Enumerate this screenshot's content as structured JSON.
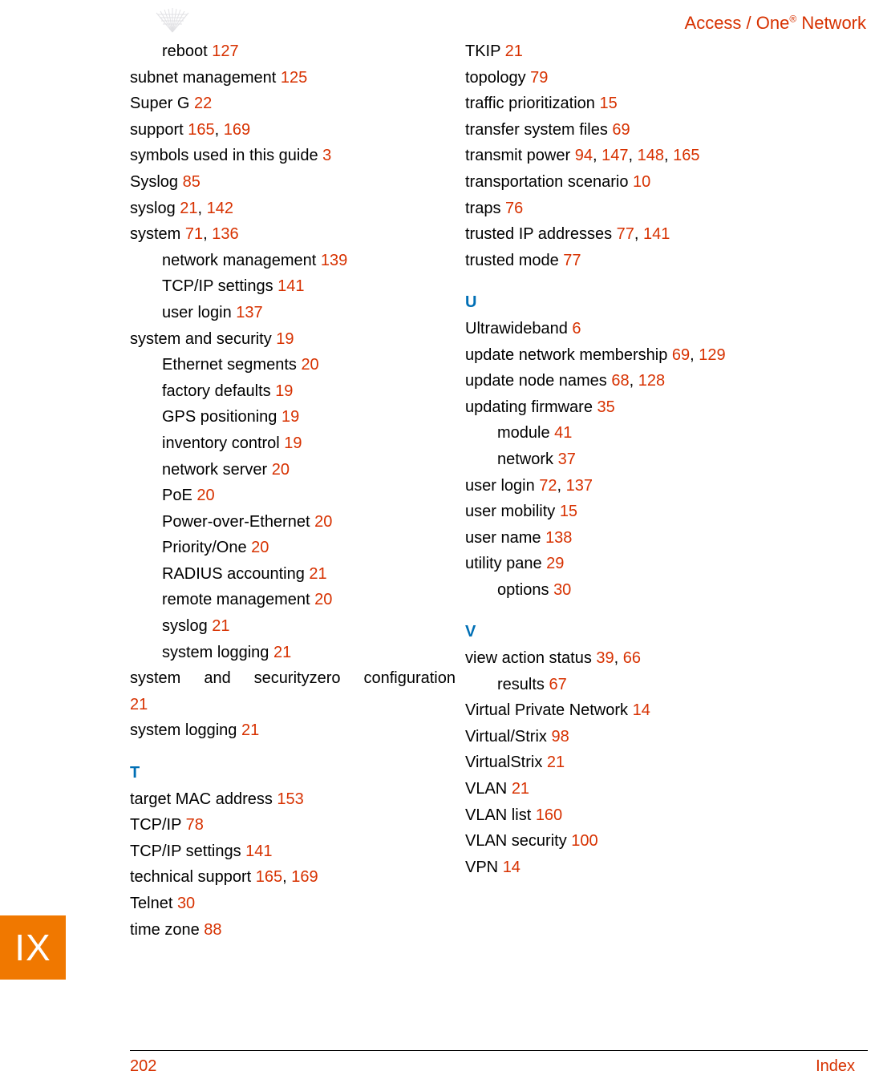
{
  "header": {
    "title_prefix": "Access / One",
    "title_suffix": " Network",
    "super": "®"
  },
  "side_tab": "IX",
  "footer": {
    "page": "202",
    "section": "Index"
  },
  "col1": [
    {
      "type": "sub",
      "text": "reboot",
      "refs": [
        "127"
      ]
    },
    {
      "type": "main",
      "text": "subnet management",
      "refs": [
        "125"
      ]
    },
    {
      "type": "main",
      "text": "Super G",
      "refs": [
        "22"
      ]
    },
    {
      "type": "main",
      "text": "support",
      "refs": [
        "165",
        "169"
      ]
    },
    {
      "type": "main",
      "text": "symbols used in this guide",
      "refs": [
        "3"
      ]
    },
    {
      "type": "main",
      "text": "Syslog",
      "refs": [
        "85"
      ]
    },
    {
      "type": "main",
      "text": "syslog",
      "refs": [
        "21",
        "142"
      ]
    },
    {
      "type": "main",
      "text": "system",
      "refs": [
        "71",
        "136"
      ]
    },
    {
      "type": "sub",
      "text": "network management",
      "refs": [
        "139"
      ]
    },
    {
      "type": "sub",
      "text": "TCP/IP settings",
      "refs": [
        "141"
      ]
    },
    {
      "type": "sub",
      "text": "user login",
      "refs": [
        "137"
      ]
    },
    {
      "type": "main",
      "text": "system and security",
      "refs": [
        "19"
      ]
    },
    {
      "type": "sub",
      "text": "Ethernet segments",
      "refs": [
        "20"
      ]
    },
    {
      "type": "sub",
      "text": "factory defaults",
      "refs": [
        "19"
      ]
    },
    {
      "type": "sub",
      "text": "GPS positioning",
      "refs": [
        "19"
      ]
    },
    {
      "type": "sub",
      "text": "inventory control",
      "refs": [
        "19"
      ]
    },
    {
      "type": "sub",
      "text": "network server",
      "refs": [
        "20"
      ]
    },
    {
      "type": "sub",
      "text": "PoE",
      "refs": [
        "20"
      ]
    },
    {
      "type": "sub",
      "text": "Power-over-Ethernet",
      "refs": [
        "20"
      ]
    },
    {
      "type": "sub",
      "text": "Priority/One",
      "refs": [
        "20"
      ]
    },
    {
      "type": "sub",
      "text": "RADIUS accounting",
      "refs": [
        "21"
      ]
    },
    {
      "type": "sub",
      "text": "remote management",
      "refs": [
        "20"
      ]
    },
    {
      "type": "sub",
      "text": "syslog",
      "refs": [
        "21"
      ]
    },
    {
      "type": "sub",
      "text": "system logging",
      "refs": [
        "21"
      ]
    },
    {
      "type": "justified",
      "text": "system and securityzero configuration"
    },
    {
      "type": "ref_only",
      "refs": [
        "21"
      ]
    },
    {
      "type": "main",
      "text": "system logging",
      "refs": [
        "21"
      ]
    },
    {
      "type": "letter",
      "text": "T"
    },
    {
      "type": "main",
      "text": "target MAC address",
      "refs": [
        "153"
      ]
    },
    {
      "type": "main",
      "text": "TCP/IP",
      "refs": [
        "78"
      ]
    },
    {
      "type": "main",
      "text": "TCP/IP settings",
      "refs": [
        "141"
      ]
    },
    {
      "type": "main",
      "text": "technical support",
      "refs": [
        "165",
        "169"
      ]
    },
    {
      "type": "main",
      "text": "Telnet",
      "refs": [
        "30"
      ]
    },
    {
      "type": "main",
      "text": "time zone",
      "refs": [
        "88"
      ]
    }
  ],
  "col2": [
    {
      "type": "main",
      "text": "TKIP",
      "refs": [
        "21"
      ]
    },
    {
      "type": "main",
      "text": "topology",
      "refs": [
        "79"
      ]
    },
    {
      "type": "main",
      "text": "traffic prioritization",
      "refs": [
        "15"
      ]
    },
    {
      "type": "main",
      "text": "transfer system files",
      "refs": [
        "69"
      ]
    },
    {
      "type": "main",
      "text": "transmit power",
      "refs": [
        "94",
        "147",
        "148",
        "165"
      ]
    },
    {
      "type": "main",
      "text": "transportation scenario",
      "refs": [
        "10"
      ]
    },
    {
      "type": "main",
      "text": "traps",
      "refs": [
        "76"
      ]
    },
    {
      "type": "main",
      "text": "trusted IP addresses",
      "refs": [
        "77",
        "141"
      ]
    },
    {
      "type": "main",
      "text": "trusted mode",
      "refs": [
        "77"
      ]
    },
    {
      "type": "letter",
      "text": "U"
    },
    {
      "type": "main",
      "text": "Ultrawideband",
      "refs": [
        "6"
      ]
    },
    {
      "type": "main",
      "text": "update network membership",
      "refs": [
        "69",
        "129"
      ]
    },
    {
      "type": "main",
      "text": "update node names",
      "refs": [
        "68",
        "128"
      ]
    },
    {
      "type": "main",
      "text": "updating firmware",
      "refs": [
        "35"
      ]
    },
    {
      "type": "sub",
      "text": "module",
      "refs": [
        "41"
      ]
    },
    {
      "type": "sub",
      "text": "network",
      "refs": [
        "37"
      ]
    },
    {
      "type": "main",
      "text": "user login",
      "refs": [
        "72",
        "137"
      ]
    },
    {
      "type": "main",
      "text": "user mobility",
      "refs": [
        "15"
      ]
    },
    {
      "type": "main",
      "text": "user name",
      "refs": [
        "138"
      ]
    },
    {
      "type": "main",
      "text": "utility pane",
      "refs": [
        "29"
      ]
    },
    {
      "type": "sub",
      "text": "options",
      "refs": [
        "30"
      ]
    },
    {
      "type": "letter",
      "text": "V"
    },
    {
      "type": "main",
      "text": "view action status",
      "refs": [
        "39",
        "66"
      ]
    },
    {
      "type": "sub",
      "text": "results",
      "refs": [
        "67"
      ]
    },
    {
      "type": "main",
      "text": "Virtual Private Network",
      "refs": [
        "14"
      ]
    },
    {
      "type": "main",
      "text": "Virtual/Strix",
      "refs": [
        "98"
      ]
    },
    {
      "type": "main",
      "text": "VirtualStrix",
      "refs": [
        "21"
      ]
    },
    {
      "type": "main",
      "text": "VLAN",
      "refs": [
        "21"
      ]
    },
    {
      "type": "main",
      "text": "VLAN list",
      "refs": [
        "160"
      ]
    },
    {
      "type": "main",
      "text": "VLAN security",
      "refs": [
        "100"
      ]
    },
    {
      "type": "main",
      "text": "VPN",
      "refs": [
        "14"
      ]
    }
  ]
}
